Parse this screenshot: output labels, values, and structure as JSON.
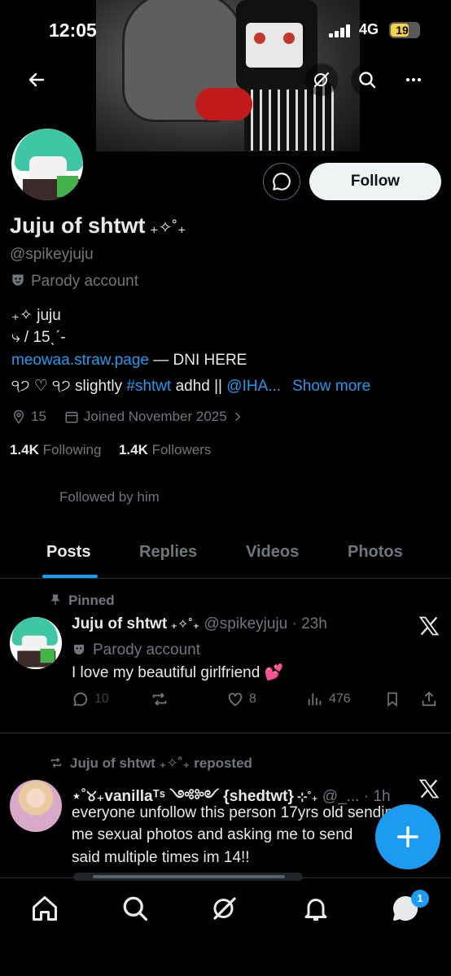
{
  "status_bar": {
    "time": "12:05",
    "network": "4G",
    "battery": "19"
  },
  "profile": {
    "name": "Juju of shtwt",
    "name_deco": " ₊✧˚₊",
    "handle": "@spikeyjuju",
    "parody": "Parody account",
    "follow_label": "Follow",
    "bio_line1": "₊✧ juju",
    "bio_line2": "⤷ / 15ˎˊ-",
    "bio_link": "meowaa.straw.page",
    "bio_link_rest": " — DNI HERE",
    "bio_line4_pre": "੧੭ ♡ ੧੭ slightly ",
    "bio_hashtag": "#shtwt",
    "bio_line4_mid": " adhd || ",
    "bio_mention": "@IHA...",
    "show_more": "Show more",
    "location": "15",
    "joined": "Joined November 2025",
    "following_count": "1.4K",
    "following_label": "Following",
    "followers_count": "1.4K",
    "followers_label": "Followers",
    "followed_by": "Followed by him"
  },
  "tabs": [
    {
      "label": "Posts"
    },
    {
      "label": "Replies"
    },
    {
      "label": "Videos"
    },
    {
      "label": "Photos"
    }
  ],
  "pinned_post": {
    "pinned_label": "Pinned",
    "name": "Juju of shtwt",
    "name_deco": " ₊✧˚₊",
    "handle_time": " @spikeyjuju · 23h",
    "parody": "Parody account",
    "text": "I love my beautiful girlfriend 💕",
    "replies": "10",
    "likes": "8",
    "views": "476"
  },
  "repost": {
    "repost_label": "Juju of shtwt ₊✧˚₊ reposted",
    "name": "⋆˚୪₊ᴠanillaᵀˢ ༺༻ {shedtwt}",
    "name_deco": " ⊹˚₊",
    "handle_time": " @_... · 1h",
    "text_line1": "everyone unfollow this person 17yrs old sending",
    "text_line2": "me sexual photos and asking me to send",
    "text_line3": "said multiple times im 14!!"
  },
  "nav": {
    "notification_badge": "1"
  }
}
